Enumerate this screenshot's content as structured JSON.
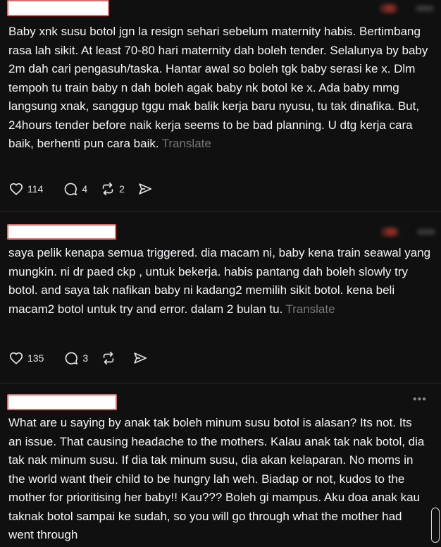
{
  "posts": [
    {
      "text": "Baby xnk susu botol jgn la resign sehari sebelum maternity habis. Bertimbang rasa lah sikit. At least 70-80 hari maternity dah boleh tender. Selalunya by baby 2m dah cari pengasuh/taska. Hantar awal so boleh tgk baby serasi ke x. Dlm tempoh tu train baby n dah boleh agak baby nk botol ke x. Ada baby mmg langsung xnak, sanggup tggu mak balik kerja baru nyusu, tu tak dinafika. But, 24hours tender before naik kerja seems to be bad planning. U dtg kerja cara baik, berhenti pun cara baik.",
      "translate": "Translate",
      "likes": "114",
      "replies": "4",
      "reposts": "2"
    },
    {
      "text": "saya pelik kenapa semua triggered. dia macam ni, baby kena train seawal yang mungkin. ni dr paed ckp , untuk bekerja. habis pantang dah boleh slowly try botol. and saya tak nafikan baby ni kadang2 memilih sikit botol. kena beli macam2 botol untuk try and error. dalam 2 bulan tu.",
      "translate": "Translate",
      "likes": "135",
      "replies": "3",
      "reposts": ""
    },
    {
      "text": "What are u saying by anak tak boleh minum susu botol is alasan? Its not. Its an issue. That causing headache to the mothers. Kalau anak tak nak botol, dia tak nak minum susu. If dia tak minum susu, dia akan kelaparan. No moms in the world want their child to be hungry lah weh. Biadap or not, kudos to the mother for prioritising her baby!! Kau??? Boleh gi mampus. Aku doa anak kau taknak botol sampai ke sudah, so you will go through what the mother had went through",
      "more": "•••"
    }
  ],
  "icons": {
    "like": "heart-icon",
    "reply": "comment-icon",
    "repost": "repost-icon",
    "share": "share-icon"
  },
  "colors": {
    "background": "#101010",
    "text": "#f3f5f7",
    "muted": "#777777",
    "redaction_border": "#e36a6a"
  }
}
